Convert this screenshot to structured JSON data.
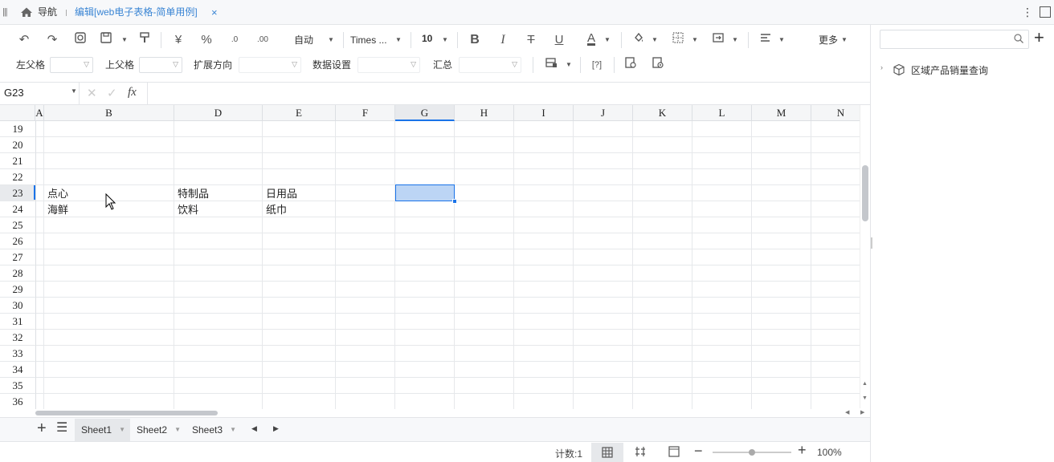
{
  "nav": {
    "menu_glyph": "|||",
    "home_label": "导航",
    "active_tab_label": "编辑[web电子表格-简单用例]",
    "close_glyph": "×"
  },
  "toolbar": {
    "currency_label": "¥",
    "percent_label": "%",
    "dec_increase_label": ".0",
    "dec_decrease_label": ".00",
    "auto_label": "自动",
    "font_family": "Times ...",
    "font_size": "10",
    "bold_label": "B",
    "italic_label": "I",
    "strike_label": "T",
    "underline_label": "U",
    "font_color_label": "A",
    "more_label": "更多",
    "left_parent_label": "左父格",
    "top_parent_label": "上父格",
    "expand_dir_label": "扩展方向",
    "data_settings_label": "数据设置",
    "summary_label": "汇总",
    "param_label": "[?]"
  },
  "formula": {
    "cell_ref": "G23",
    "fx_label": "fx"
  },
  "grid": {
    "columns": [
      "A",
      "B",
      "D",
      "E",
      "F",
      "G",
      "H",
      "I",
      "J",
      "K",
      "L",
      "M",
      "N"
    ],
    "rows": [
      "19",
      "20",
      "21",
      "22",
      "23",
      "24",
      "25",
      "26",
      "27",
      "28",
      "29",
      "30",
      "31",
      "32",
      "33",
      "34",
      "35",
      "36"
    ],
    "cells": {
      "B23": "点心",
      "D23": "特制品",
      "E23": "日用品",
      "B24": "海鲜",
      "D24": "饮料",
      "E24": "纸巾"
    },
    "selected_cell": "G23",
    "selection_color": "#bcd5f5",
    "accent_color": "#1a73e8"
  },
  "sheets": {
    "tabs": [
      "Sheet1",
      "Sheet2",
      "Sheet3"
    ],
    "active": "Sheet1"
  },
  "status": {
    "count_label": "计数:1",
    "zoom": "100%"
  },
  "right_panel": {
    "search_placeholder": "",
    "tree_item": "区域产品销量查询"
  }
}
